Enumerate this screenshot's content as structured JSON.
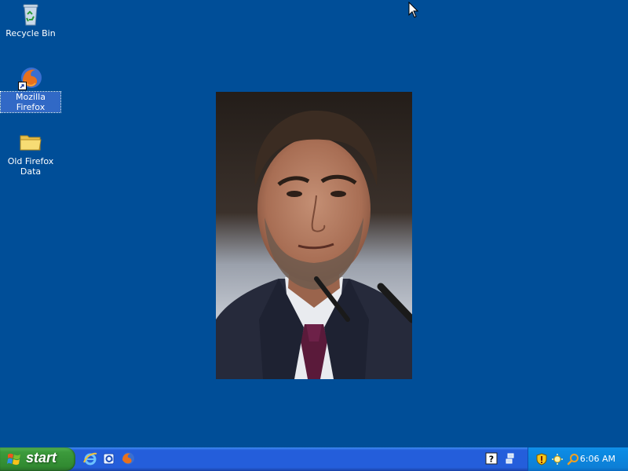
{
  "desktop": {
    "background_color": "#004e98",
    "icons": [
      {
        "label": "Recycle Bin",
        "icon": "recycle-bin-icon"
      },
      {
        "label": "Mozilla Firefox",
        "icon": "firefox-icon"
      },
      {
        "label": "Old Firefox Data",
        "icon": "folder-icon"
      }
    ],
    "wallpaper_photo": "portrait-photo"
  },
  "taskbar": {
    "start_label": "start",
    "quick_launch": [
      "internet-explorer-icon",
      "outlook-express-icon",
      "firefox-icon"
    ],
    "tray_left": [
      "help-icon",
      "network-icon"
    ],
    "tray_icons": [
      "security-shield-icon",
      "network-activity-icon",
      "search-icon"
    ],
    "clock": "6:06 AM"
  },
  "colors": {
    "taskbar_blue": "#245edb",
    "start_green": "#3c9a3c",
    "tray_blue": "#0d7fd6"
  }
}
